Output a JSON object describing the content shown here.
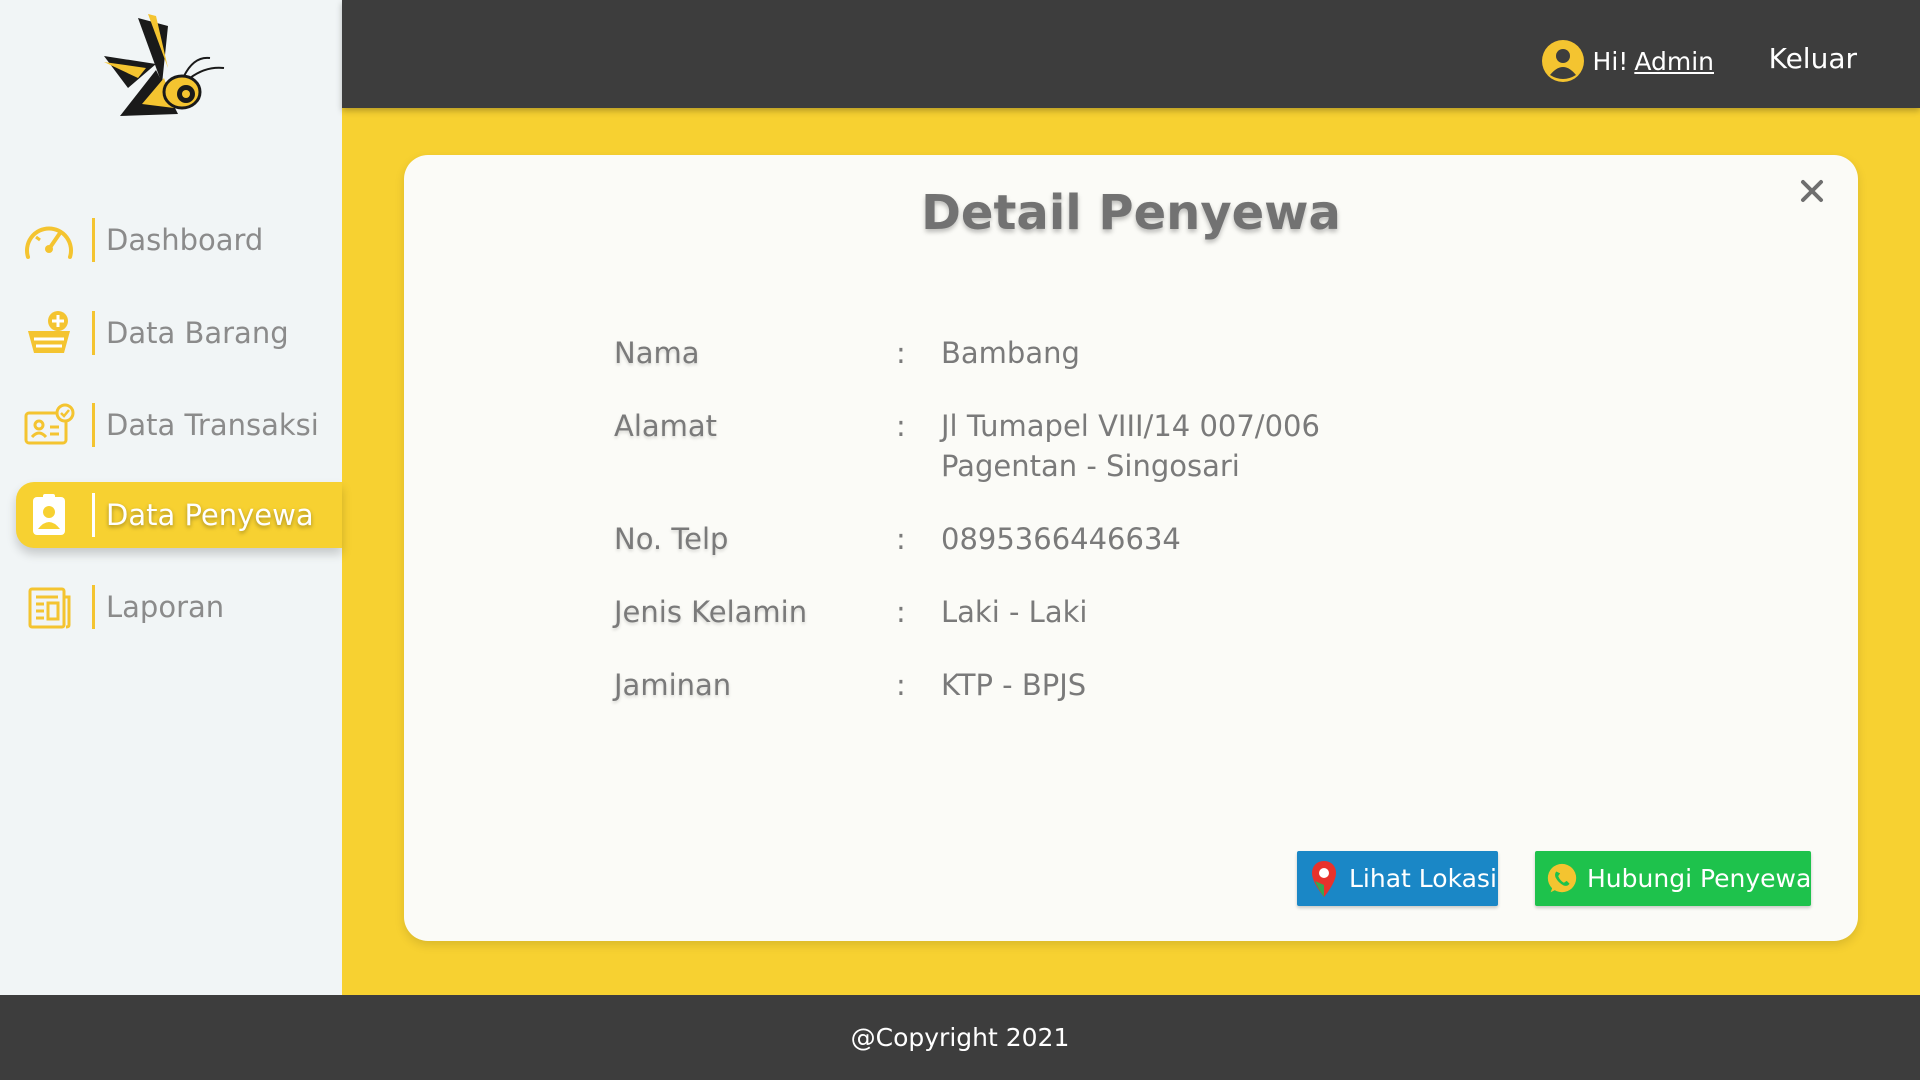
{
  "header": {
    "greeting": "Hi!",
    "user_name": "Admin",
    "logout_label": "Keluar"
  },
  "sidebar": {
    "items": [
      {
        "label": "Dashboard",
        "icon": "speedometer-icon",
        "active": false
      },
      {
        "label": "Data Barang",
        "icon": "basket-add-icon",
        "active": false
      },
      {
        "label": "Data Transaksi",
        "icon": "id-card-check-icon",
        "active": false
      },
      {
        "label": "Data Penyewa",
        "icon": "contact-book-icon",
        "active": true
      },
      {
        "label": "Laporan",
        "icon": "report-document-icon",
        "active": false
      }
    ]
  },
  "detail": {
    "title": "Detail Penyewa",
    "fields": [
      {
        "label": "Nama",
        "value": "Bambang"
      },
      {
        "label": "Alamat",
        "value_line1": "Jl Tumapel VIII/14 007/006",
        "value_line2": "Pagentan - Singosari"
      },
      {
        "label": "No. Telp",
        "value": "0895366446634"
      },
      {
        "label": "Jenis Kelamin",
        "value": "Laki - Laki"
      },
      {
        "label": "Jaminan",
        "value": "KTP - BPJS"
      }
    ],
    "separator": ":",
    "location_button": "Lihat Lokasi",
    "contact_button": "Hubungi Penyewa"
  },
  "footer": {
    "copyright": "@Copyright 2021"
  },
  "colors": {
    "accent": "#f7d131",
    "dark": "#3d3d3d",
    "location_button": "#1a87c6",
    "whatsapp_button": "#1ec24c"
  }
}
